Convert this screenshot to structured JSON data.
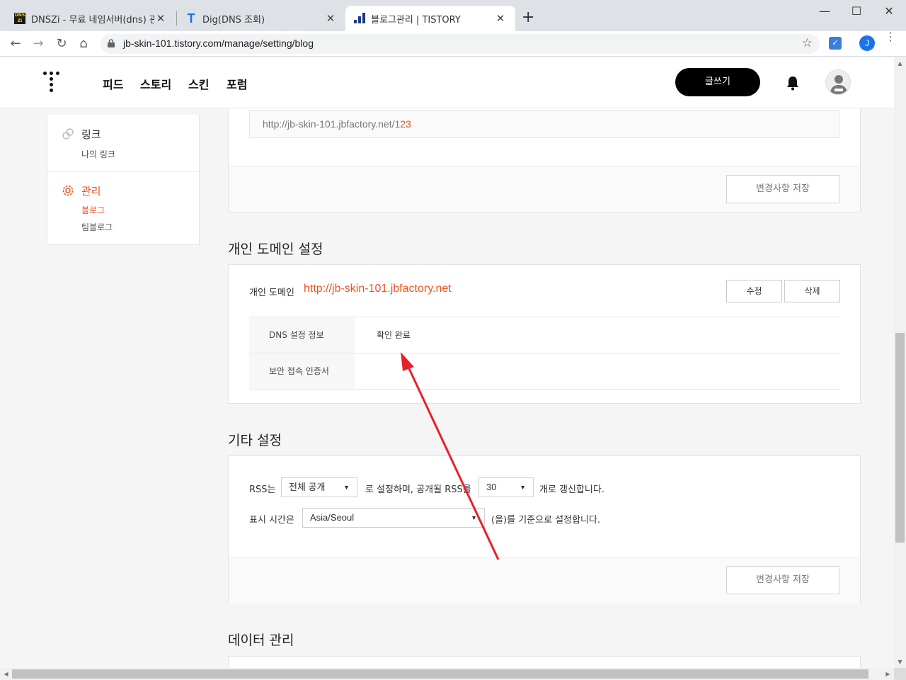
{
  "browser": {
    "tabs": [
      {
        "title": "DNSZi - 무료 네임서버(dns) 관리",
        "favicon": "dnszi-icon",
        "favicon_text": "DNS Zi"
      },
      {
        "title": "Dig(DNS 조회)",
        "favicon": "t-icon",
        "favicon_text": "T"
      },
      {
        "title": "블로그관리 | TISTORY",
        "favicon": "tistory-bars-icon"
      }
    ],
    "close_glyph": "✕",
    "new_tab_glyph": "+",
    "window_controls": [
      "—",
      "☐",
      "✕"
    ],
    "url": "jb-skin-101.tistory.com/manage/setting/blog",
    "profile_initial": "J",
    "nav_glyphs": {
      "back": "←",
      "forward": "→",
      "reload": "↻",
      "home": "⌂",
      "star": "☆",
      "menu": "⋮"
    }
  },
  "header": {
    "nav": [
      "피드",
      "스토리",
      "스킨",
      "포럼"
    ],
    "write_button": "글쓰기"
  },
  "sidebar": {
    "link": {
      "title": "링크",
      "items": [
        "나의 링크"
      ]
    },
    "manage": {
      "title": "관리",
      "items": [
        {
          "label": "블로그",
          "active": true
        },
        {
          "label": "팀블로그",
          "active": false
        }
      ]
    }
  },
  "address_section": {
    "url_prefix": "http://jb-skin-101.jbfactory.net/",
    "url_suffix": "123",
    "save_button": "변경사항 저장"
  },
  "domain_section": {
    "title": "개인 도메인 설정",
    "label": "개인 도메인",
    "domain": "http://jb-skin-101.jbfactory.net",
    "edit_button": "수정",
    "delete_button": "삭제",
    "rows": [
      {
        "label": "DNS 설정 정보",
        "value": "확인 완료"
      },
      {
        "label": "보안 접속 인증서",
        "value": ""
      }
    ]
  },
  "etc_section": {
    "title": "기타 설정",
    "rss_prefix": "RSS는",
    "rss_select": "전체 공개",
    "rss_mid": "로 설정하며, 공개될 RSS를",
    "rss_count": "30",
    "rss_suffix": "개로 갱신합니다.",
    "time_prefix": "표시 시간은",
    "timezone": "Asia/Seoul",
    "time_suffix": "(을)를 기준으로 설정합니다.",
    "save_button": "변경사항 저장"
  },
  "data_section": {
    "title": "데이터 관리"
  },
  "colors": {
    "accent": "#eb531f",
    "arrow": "#e8202a",
    "write_button_bg": "#000000"
  }
}
